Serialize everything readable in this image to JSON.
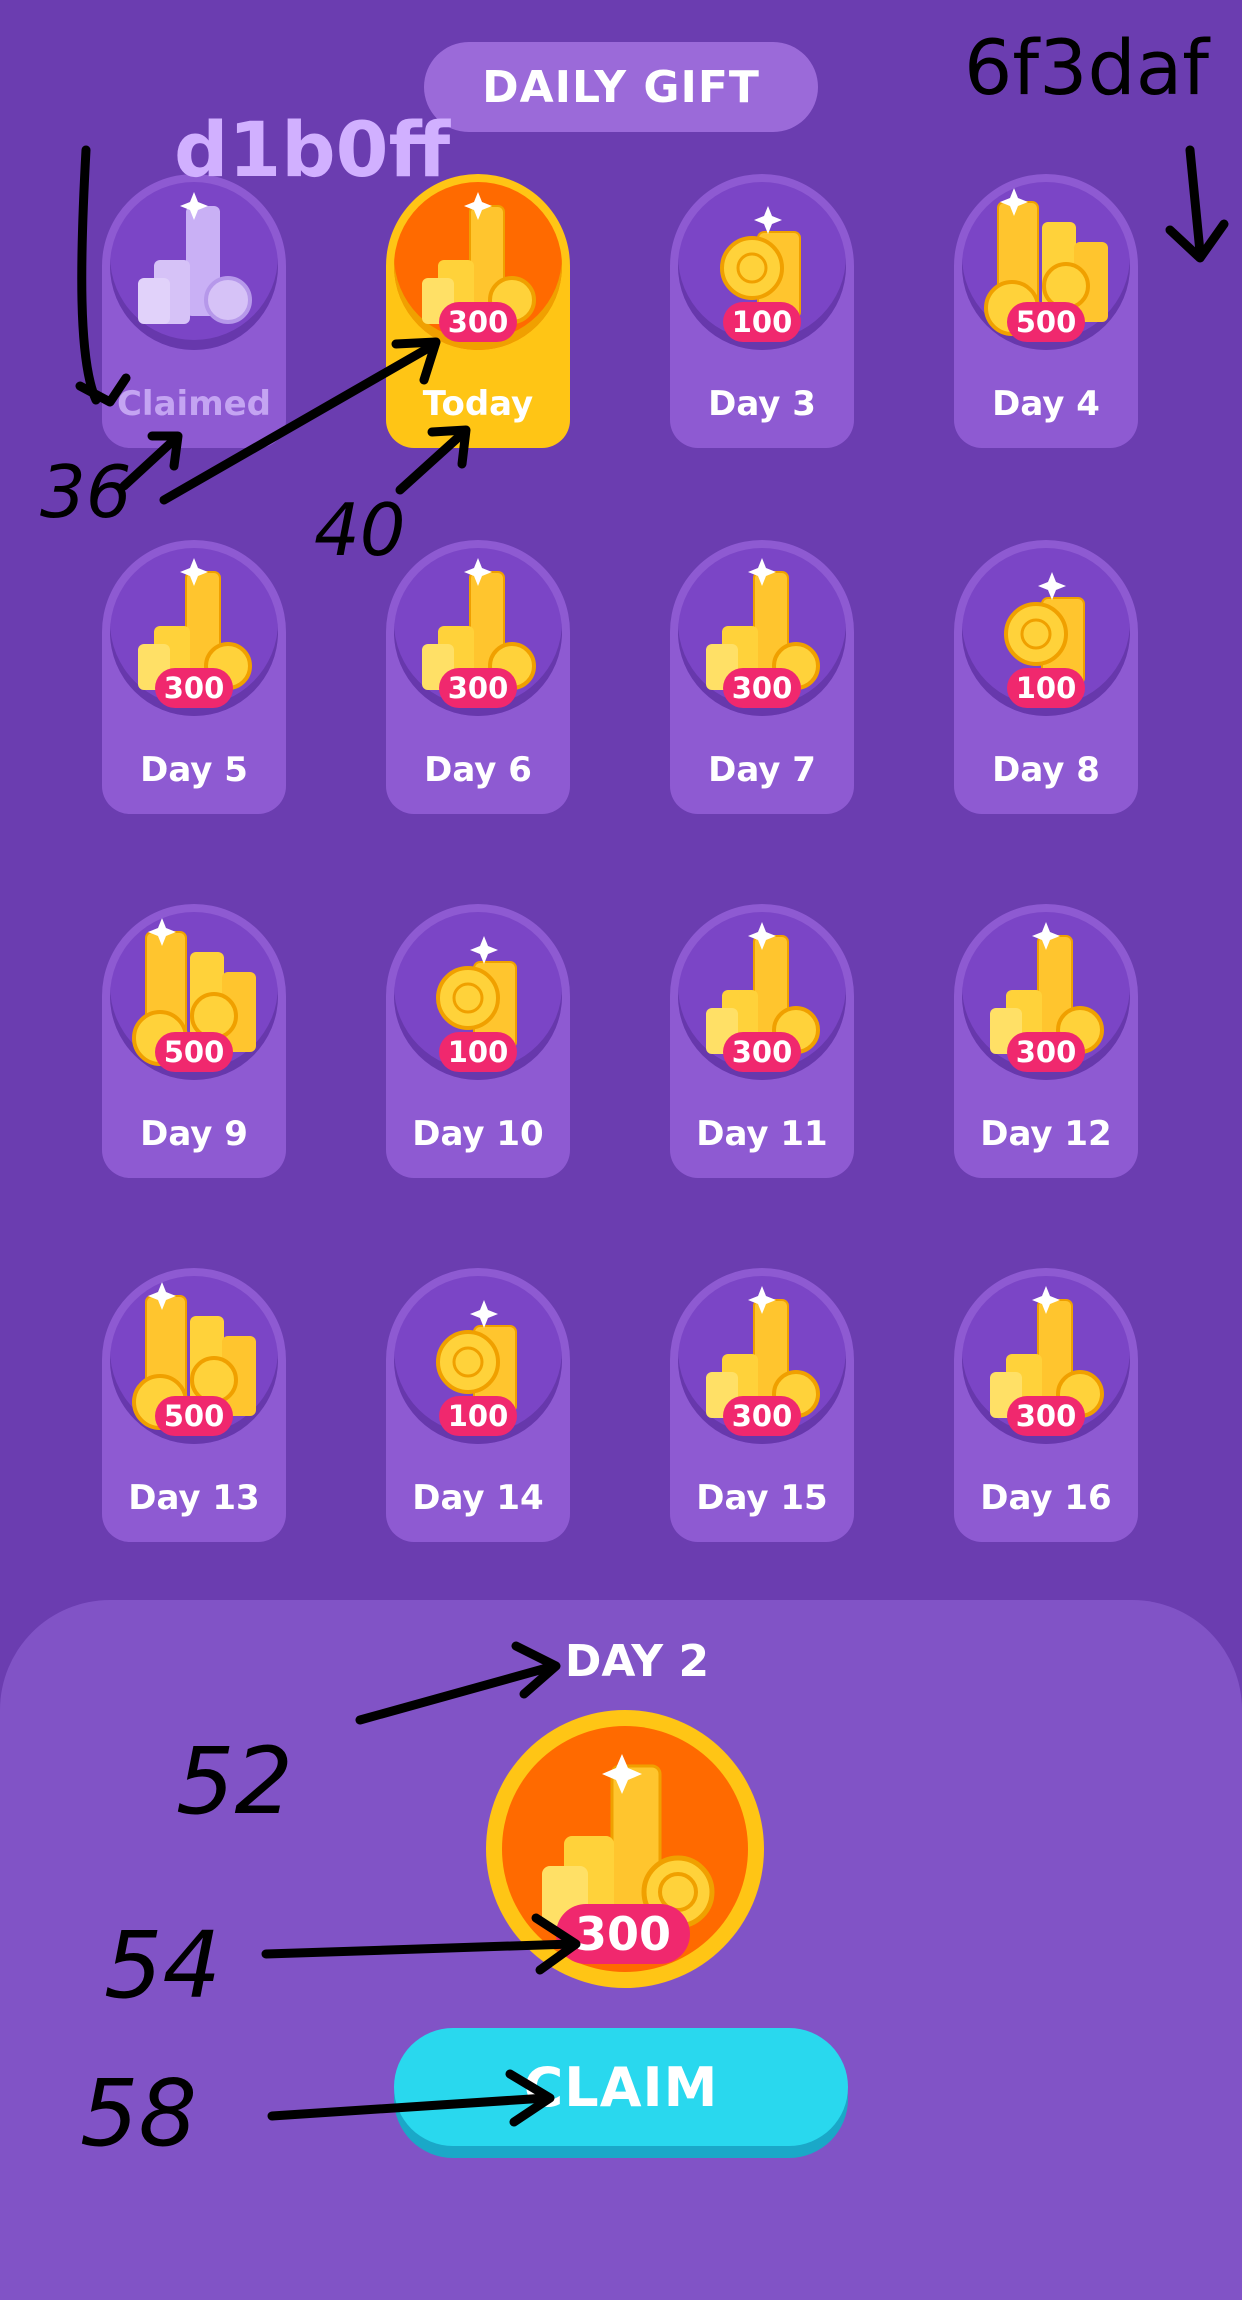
{
  "header": {
    "title": "DAILY GIFT"
  },
  "cards": [
    {
      "amount": "",
      "label": "Claimed",
      "state": "claimed",
      "coins": "stack"
    },
    {
      "amount": "300",
      "label": "Today",
      "state": "today",
      "coins": "stack"
    },
    {
      "amount": "100",
      "label": "Day 3",
      "state": "future",
      "coins": "small"
    },
    {
      "amount": "500",
      "label": "Day 4",
      "state": "future",
      "coins": "large"
    },
    {
      "amount": "300",
      "label": "Day 5",
      "state": "future",
      "coins": "stack"
    },
    {
      "amount": "300",
      "label": "Day 6",
      "state": "future",
      "coins": "stack"
    },
    {
      "amount": "300",
      "label": "Day 7",
      "state": "future",
      "coins": "stack"
    },
    {
      "amount": "100",
      "label": "Day 8",
      "state": "future",
      "coins": "small"
    },
    {
      "amount": "500",
      "label": "Day 9",
      "state": "future",
      "coins": "large"
    },
    {
      "amount": "100",
      "label": "Day 10",
      "state": "future",
      "coins": "small"
    },
    {
      "amount": "300",
      "label": "Day 11",
      "state": "future",
      "coins": "stack"
    },
    {
      "amount": "300",
      "label": "Day 12",
      "state": "future",
      "coins": "stack"
    },
    {
      "amount": "500",
      "label": "Day 13",
      "state": "future",
      "coins": "large"
    },
    {
      "amount": "100",
      "label": "Day 14",
      "state": "future",
      "coins": "small"
    },
    {
      "amount": "300",
      "label": "Day 15",
      "state": "future",
      "coins": "stack"
    },
    {
      "amount": "300",
      "label": "Day 16",
      "state": "future",
      "coins": "stack"
    }
  ],
  "reward": {
    "title": "DAY 2",
    "amount": "300",
    "claim_label": "CLAIM"
  },
  "annotations": {
    "codes": [
      "d1b0ff",
      "6f3daf"
    ],
    "numbers": [
      "36",
      "40",
      "52",
      "54",
      "58"
    ]
  },
  "colors": {
    "background": "#6b3db0",
    "card": "#8e5ad2",
    "today_card": "#ffc515",
    "badge": "#f0286e",
    "claim_button": "#29d8ee"
  }
}
